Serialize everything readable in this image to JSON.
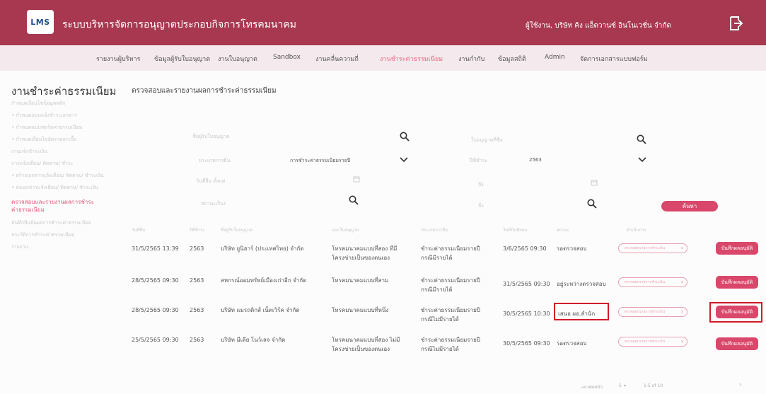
{
  "header": {
    "logo_text": "LMS",
    "system_title": "ระบบบริหารจัดการอนุญาตประกอบกิจการโทรคมนาคม",
    "user_info": "ผู้ใช้งาน, บริษัท คิง แอ็ดวานซ์ อินโนเวชั่น จำกัด"
  },
  "nav": [
    "รายงานผู้บริหาร",
    "ข้อมูลผู้รับใบอนุญาต",
    "งานใบอนุญาต",
    "Sandbox",
    "งานคลื่นความถี่",
    "งานชำระค่าธรรมเนียม",
    "งานกำกับ",
    "ข้อมูลสถิติ",
    "Admin",
    "จัดการเอกสารแบบฟอร์ม"
  ],
  "sidebar": {
    "title": "งานชำระค่าธรรมเนียม",
    "items": [
      "กำหนดเงื่อนไขข้อมูลหลัก",
      "• กำหนดแบบแจ้งชำระเอกสาร",
      "• กำหนดแบบฟอร์มค่าธรรมเนียม",
      "• กำหนดเงื่อนไขอัตราดอกเบี้ย",
      "งานแจ้งชำระเงิน",
      "การแจ้งเตือน/ ติดตาม/ ชำระ",
      "• สร้างเอกสารแจ้งเตือน/ ติดตาม/ ชำระเงิน",
      "• ส่งเอกสารแจ้งเตือน/ ติดตาม/ ชำระเงิน",
      "ตรวจสอบและรายงานผลการชำระ",
      "ค่าธรรมเนียม",
      "บันทึกยืนยันผลการชำระค่าธรรมเนียม",
      "ประวัติการชำระค่าธรรมเนียม",
      "รายงาน"
    ]
  },
  "main": {
    "title": "ตรวจสอบและรายงานผลการชำระค่าธรรมเนียม",
    "filters": {
      "licensee_label": "ชื่อผู้รับใบอนุญาต",
      "license_no_label": "ใบอนุญาตที่ชื่อ",
      "fee_type_label": "ประเภทการยื่น",
      "fee_type_value": "การชำระค่าธรรมเนียมรายปี",
      "year_label": "ปีที่ชำระ",
      "year_value": "2563",
      "date_label": "วันที่ยื่น ตั้งแต่",
      "to_label": "ถึง",
      "status_label": "สถานะเรื่อง",
      "to_label2": "ถึง",
      "search_button": "ค้นหา"
    },
    "table": {
      "headers": [
        "วันที่ยื่น",
        "ปีที่ชำระ",
        "ชื่อผู้รับใบอนุญาต",
        "แบบใบอนุญาต",
        "ประเภทการยื่น",
        "วันที่บันทึกผล",
        "สถานะ",
        "ดำเนินการ"
      ],
      "rows": [
        {
          "date": "31/5/2565 13:39",
          "year": "2563",
          "company": "บริษัท ยูนิฮาร์ (ประเทศไทย) จำกัด",
          "license_type": "โทรคมนาคมแบบที่สอง ที่มีโครงข่ายเป็นของตนเอง",
          "submit_type": "ชำระค่าธรรมเนียมรายปี กรณีมีรายได้",
          "record_date": "3/6/2565 09:30",
          "status": "รอตรวจสอบ",
          "action_link": "ตรวจสอบรายการชำระเงิน",
          "action_button": "บันทึกผลอนุมัติ"
        },
        {
          "date": "28/5/2565 09:30",
          "year": "2563",
          "company": "สหกรณ์ออมทรัพย์เมืองเก่าอีก จำกัด",
          "license_type": "โทรคมนาคมแบบที่สาม",
          "submit_type": "ชำระค่าธรรมเนียมรายปี กรณีมีรายได้",
          "record_date": "31/5/2565 09:30",
          "status": "อยู่ระหว่างตรวจสอบ",
          "action_link": "ตรวจสอบรายการชำระเงิน",
          "action_button": "บันทึกผลอนุมัติ"
        },
        {
          "date": "28/5/2565 09:30",
          "year": "2563",
          "company": "บริษัท แมรถติกส์ เน็ตเวิร์ค จำกัด",
          "license_type": "โทรคมนาคมแบบที่หนึ่ง",
          "submit_type": "ชำระค่าธรรมเนียมรายปี กรณีไม่มีรายได้",
          "record_date": "30/5/2565 10:30",
          "status": "เสนอ ผอ.สำนัก",
          "action_link": "ตรวจสอบรายการชำระเงิน",
          "action_button": "บันทึกผลอนุมัติ"
        },
        {
          "date": "25/5/2565 09:30",
          "year": "2563",
          "company": "บริษัท มีเดีย โนว์เลจ จำกัด",
          "license_type": "โทรคมนาคมแบบที่สอง ไม่มีโครงข่ายเป็นของตนเอง",
          "submit_type": "ชำระค่าธรรมเนียมรายปี กรณีไม่มีรายได้",
          "record_date": "30/5/2565 09:30",
          "status": "รอตรวจสอบ",
          "action_link": "ตรวจสอบรายการชำระเงิน",
          "action_button": "บันทึกผลอนุมัติ"
        }
      ]
    },
    "pagination": {
      "rows_label": "แถวต่อหน้า:",
      "rows_value": "5",
      "range": "1-5 of 10"
    }
  },
  "colors": {
    "brand": "#a83850",
    "accent": "#d9476a",
    "highlight_box": "#d21a2a"
  }
}
